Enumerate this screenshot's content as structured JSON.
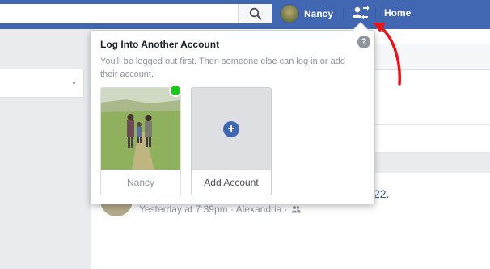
{
  "topbar": {
    "profile_name": "Nancy",
    "home_label": "Home",
    "icons": {
      "search": "search-icon",
      "switch_account": "account-switch-icon"
    }
  },
  "background": {
    "post_title_fragment": "22.",
    "post_meta": "Yesterday at 7:39pm · Alexandria ·"
  },
  "dropdown": {
    "title": "Log Into Another Account",
    "description": "You'll be logged out first. Then someone else can log in or add their account.",
    "help_label": "?",
    "accounts": [
      {
        "name": "Nancy",
        "online": true
      },
      {
        "name": "Add Account",
        "icon": "plus-icon"
      }
    ]
  },
  "colors": {
    "brand": "#4267b2",
    "online": "#1ec51b",
    "annotation_arrow": "#e8141c"
  }
}
